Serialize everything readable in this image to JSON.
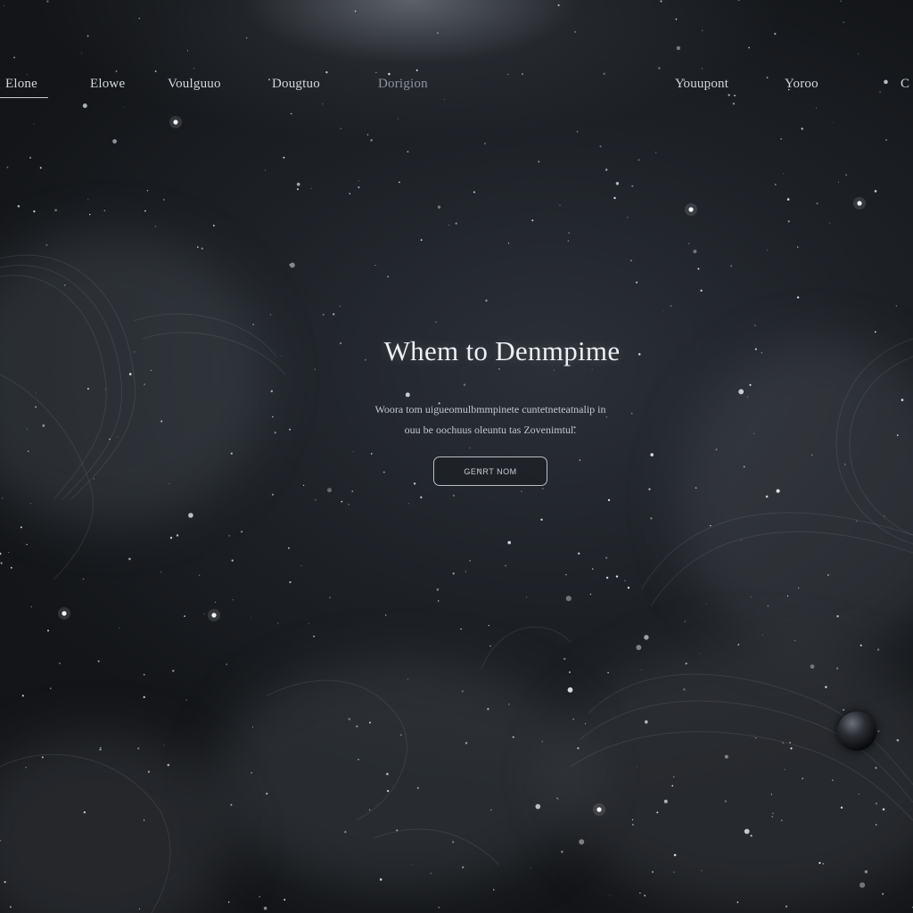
{
  "nav": {
    "items": [
      {
        "label": "Elone",
        "active": true,
        "dim": false
      },
      {
        "label": "Elowe",
        "active": false,
        "dim": false
      },
      {
        "label": "Voulguuo",
        "active": false,
        "dim": false
      },
      {
        "label": "Dougtuo",
        "active": false,
        "dim": false
      },
      {
        "label": "Dorigion",
        "active": false,
        "dim": true
      },
      {
        "label": "Youupont",
        "active": false,
        "dim": false
      },
      {
        "label": "Yoroo",
        "active": false,
        "dim": false
      },
      {
        "label": "C",
        "active": false,
        "dim": false
      }
    ]
  },
  "hero": {
    "title": "Whem to Denmpime",
    "subtitle_line1": "Woora tom uigueomulbmmpinete cuntetneteatnalip in",
    "subtitle_line2": "ouu be oochuus oleuntu tas Zovenimtul.",
    "cta_label": "GENRT NOM"
  },
  "colors": {
    "background": "#1b1e22",
    "text": "#eef0f3",
    "accent": "#c9cdd2"
  }
}
